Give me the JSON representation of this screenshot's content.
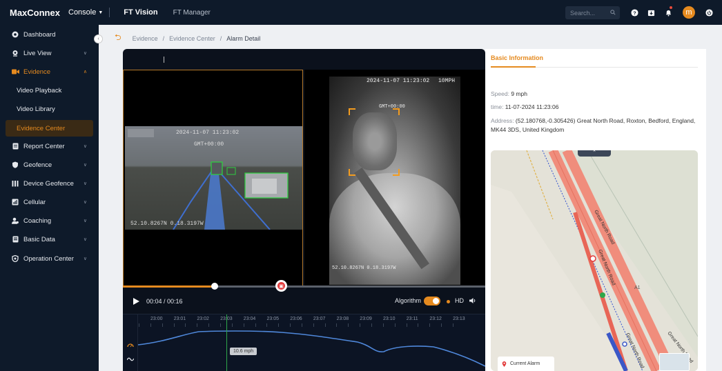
{
  "header": {
    "brand": "MaxConnex",
    "console_label": "Console",
    "nav_ft_vision": "FT Vision",
    "nav_ft_manager": "FT Manager",
    "search_placeholder": "Search...",
    "avatar_initial": "m",
    "icons": [
      "help-icon",
      "download-icon",
      "bell-icon",
      "power-icon"
    ]
  },
  "sidebar": {
    "items": [
      {
        "label": "Dashboard",
        "icon": "dashboard-icon"
      },
      {
        "label": "Live View",
        "icon": "camera-icon"
      },
      {
        "label": "Evidence",
        "icon": "video-icon"
      },
      {
        "label": "Video Playback"
      },
      {
        "label": "Video Library"
      },
      {
        "label": "Evidence Center"
      },
      {
        "label": "Report Center",
        "icon": "report-icon"
      },
      {
        "label": "Geofence",
        "icon": "shield-icon"
      },
      {
        "label": "Device Geofence",
        "icon": "device-geofence-icon"
      },
      {
        "label": "Cellular",
        "icon": "cellular-icon"
      },
      {
        "label": "Coaching",
        "icon": "coaching-icon"
      },
      {
        "label": "Basic Data",
        "icon": "data-icon"
      },
      {
        "label": "Operation Center",
        "icon": "operation-icon"
      }
    ]
  },
  "breadcrumb": {
    "items": [
      "Evidence",
      "Evidence Center",
      "Alarm Detail"
    ],
    "separator": "/"
  },
  "video": {
    "road_cam": {
      "timestamp": "2024-11-07 11:23:02",
      "gmt": "GMT+00:00",
      "coord": "52.10.8267N 0.18.3197W"
    },
    "cabin_cam": {
      "timestamp": "2024-11-07 11:23:02",
      "speed": "10MPH",
      "gmt": "GMT+00:00",
      "coord": "52.10.8267N 0.18.3197W"
    },
    "progress_fraction": 0.254,
    "time_display": "00:04 / 00:16",
    "algorithm_label": "Algorithm",
    "algorithm_on": true,
    "hd_label": "HD"
  },
  "timeline": {
    "ticks": [
      "23:00",
      "23:01",
      "23:02",
      "23:03",
      "23:04",
      "23:05",
      "23:06",
      "23:07",
      "23:08",
      "23:09",
      "23:10",
      "23:11",
      "23:12",
      "23:13"
    ],
    "speed_tip": "10.6 mph"
  },
  "info": {
    "tab_label": "Basic Information",
    "speed_key": "Speed",
    "speed_val": "9 mph",
    "time_key": "time",
    "time_val": "11-07-2024 11:23:06",
    "address_key": "Address",
    "address_line1": "(52.180768,-0.305426) Great North Road, Roxton, Bedford, England,",
    "address_line2": "MK44 3DS, United Kingdom",
    "map": {
      "road_label": "Great North Road",
      "a1_label": "A1",
      "legend_label": "Current Alarm"
    }
  },
  "colors": {
    "accent": "#e58a1f",
    "nav_bg": "#0e1a2a",
    "alarm_red": "#e23b3b",
    "cursor_green": "#2ea84a"
  }
}
